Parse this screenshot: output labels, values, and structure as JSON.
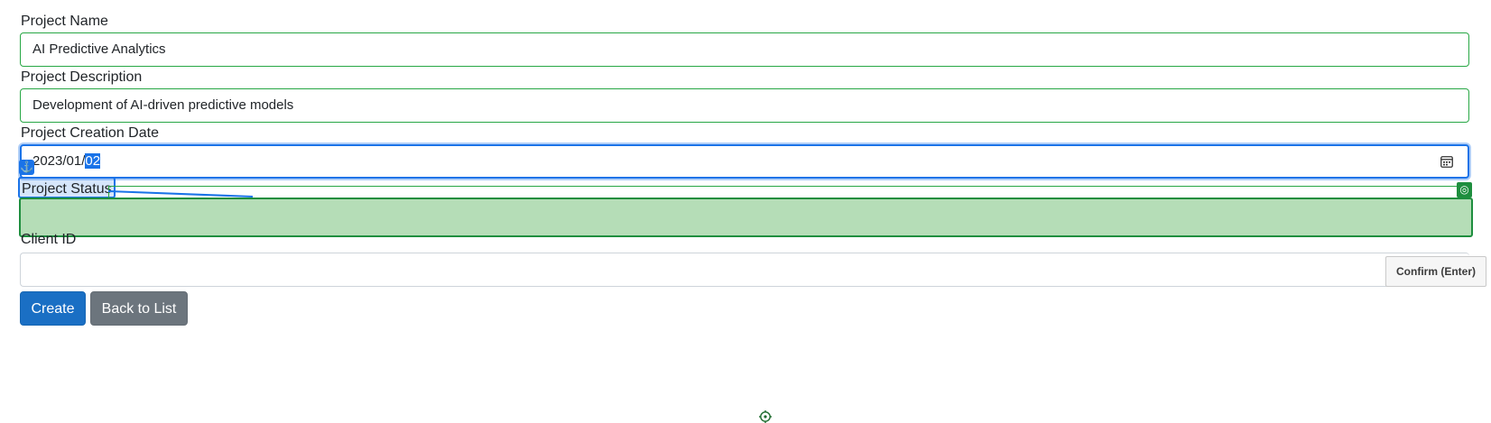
{
  "form": {
    "project_name": {
      "label": "Project Name",
      "value": "AI Predictive Analytics"
    },
    "project_description": {
      "label": "Project Description",
      "value": "Development of AI-driven predictive models"
    },
    "creation_date": {
      "label": "Project Creation Date",
      "value_prefix": "2023/01/",
      "value_selected": "02"
    },
    "project_status": {
      "label": "Project Status"
    },
    "client_id": {
      "label": "Client ID",
      "value": ""
    }
  },
  "buttons": {
    "create": "Create",
    "back": "Back to List"
  },
  "overlay": {
    "confirm_tooltip": "Confirm (Enter)",
    "anchor_icon": "anchor-icon",
    "target_icon": "target-icon"
  },
  "colors": {
    "accent_blue": "#1a73e8",
    "valid_green": "#28a745",
    "target_fill": "#b5ddb7",
    "secondary": "#6c757d"
  }
}
